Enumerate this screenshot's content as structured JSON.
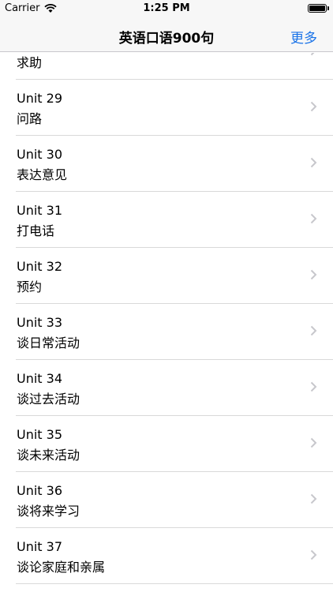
{
  "status_bar": {
    "carrier": "Carrier",
    "time": "1:25 PM",
    "battery_level": 1.0
  },
  "nav": {
    "title": "英语口语900句",
    "more_label": "更多"
  },
  "rows": [
    {
      "unit": "",
      "title": "求助"
    },
    {
      "unit": "Unit 29",
      "title": "问路"
    },
    {
      "unit": "Unit 30",
      "title": "表达意见"
    },
    {
      "unit": "Unit 31",
      "title": "打电话"
    },
    {
      "unit": "Unit 32",
      "title": "预约"
    },
    {
      "unit": "Unit 33",
      "title": "谈日常活动"
    },
    {
      "unit": "Unit 34",
      "title": "谈过去活动"
    },
    {
      "unit": "Unit 35",
      "title": "谈未来活动"
    },
    {
      "unit": "Unit 36",
      "title": "谈将来学习"
    },
    {
      "unit": "Unit 37",
      "title": "谈论家庭和亲属"
    }
  ]
}
